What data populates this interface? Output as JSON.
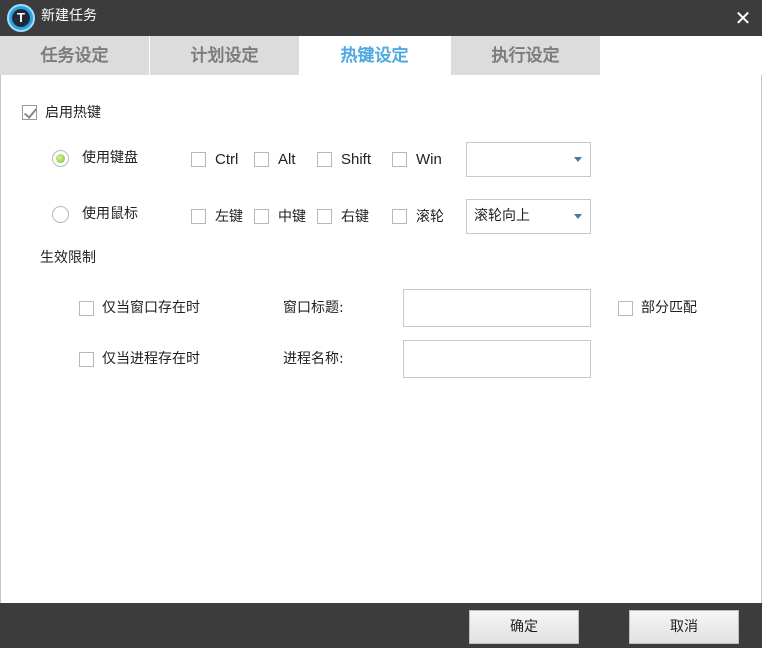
{
  "window": {
    "title": "新建任务",
    "icon": "app-logo-icon",
    "icon_letter": "T",
    "close": "✕"
  },
  "tabs": [
    {
      "label": "任务设定",
      "active": false
    },
    {
      "label": "计划设定",
      "active": false
    },
    {
      "label": "热键设定",
      "active": true
    },
    {
      "label": "执行设定",
      "active": false
    }
  ],
  "hotkey": {
    "enable_label": "启用热键",
    "enabled": true,
    "keyboard": {
      "label": "使用键盘",
      "selected": true,
      "modifiers": [
        "Ctrl",
        "Alt",
        "Shift",
        "Win"
      ],
      "key_value": ""
    },
    "mouse": {
      "label": "使用鼠标",
      "selected": false,
      "buttons": [
        "左键",
        "中键",
        "右键",
        "滚轮"
      ],
      "action_value": "滚轮向上"
    }
  },
  "limit": {
    "section_label": "生效限制",
    "window_exists_label": "仅当窗口存在时",
    "window_title_label": "窗口标题:",
    "window_title_value": "",
    "partial_match_label": "部分匹配",
    "process_exists_label": "仅当进程存在时",
    "process_name_label": "进程名称:",
    "process_name_value": ""
  },
  "footer": {
    "ok_label": "确定",
    "cancel_label": "取消"
  },
  "colors": {
    "titlebar": "#3c3c3c",
    "active_tab_text": "#4fa8e0",
    "inactive_tab_bg": "#dcdcdc"
  }
}
